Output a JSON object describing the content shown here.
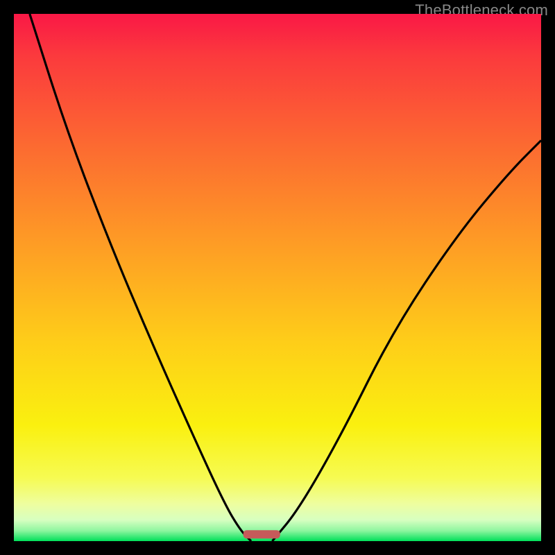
{
  "watermark": "TheBottleneck.com",
  "chart_data": {
    "type": "line",
    "title": "",
    "xlabel": "",
    "ylabel": "",
    "xlim": [
      0,
      1
    ],
    "ylim": [
      0,
      1
    ],
    "background": {
      "top_color": "#fa1846",
      "bottom_color": "#00e05a",
      "description": "vertical red-to-green gradient indicating bottleneck severity"
    },
    "series": [
      {
        "name": "left-curve",
        "x": [
          0.03,
          0.1,
          0.18,
          0.26,
          0.34,
          0.4,
          0.43,
          0.45
        ],
        "values": [
          1.0,
          0.78,
          0.57,
          0.38,
          0.2,
          0.07,
          0.02,
          0.0
        ]
      },
      {
        "name": "right-curve",
        "x": [
          0.49,
          0.54,
          0.62,
          0.72,
          0.84,
          0.94,
          1.0
        ],
        "values": [
          0.0,
          0.06,
          0.2,
          0.4,
          0.58,
          0.7,
          0.76
        ]
      }
    ],
    "marker": {
      "name": "minimum-band",
      "x_center": 0.47,
      "y": 0.005,
      "width": 0.07,
      "color": "#c65a5a",
      "shape": "rounded-bar"
    }
  }
}
